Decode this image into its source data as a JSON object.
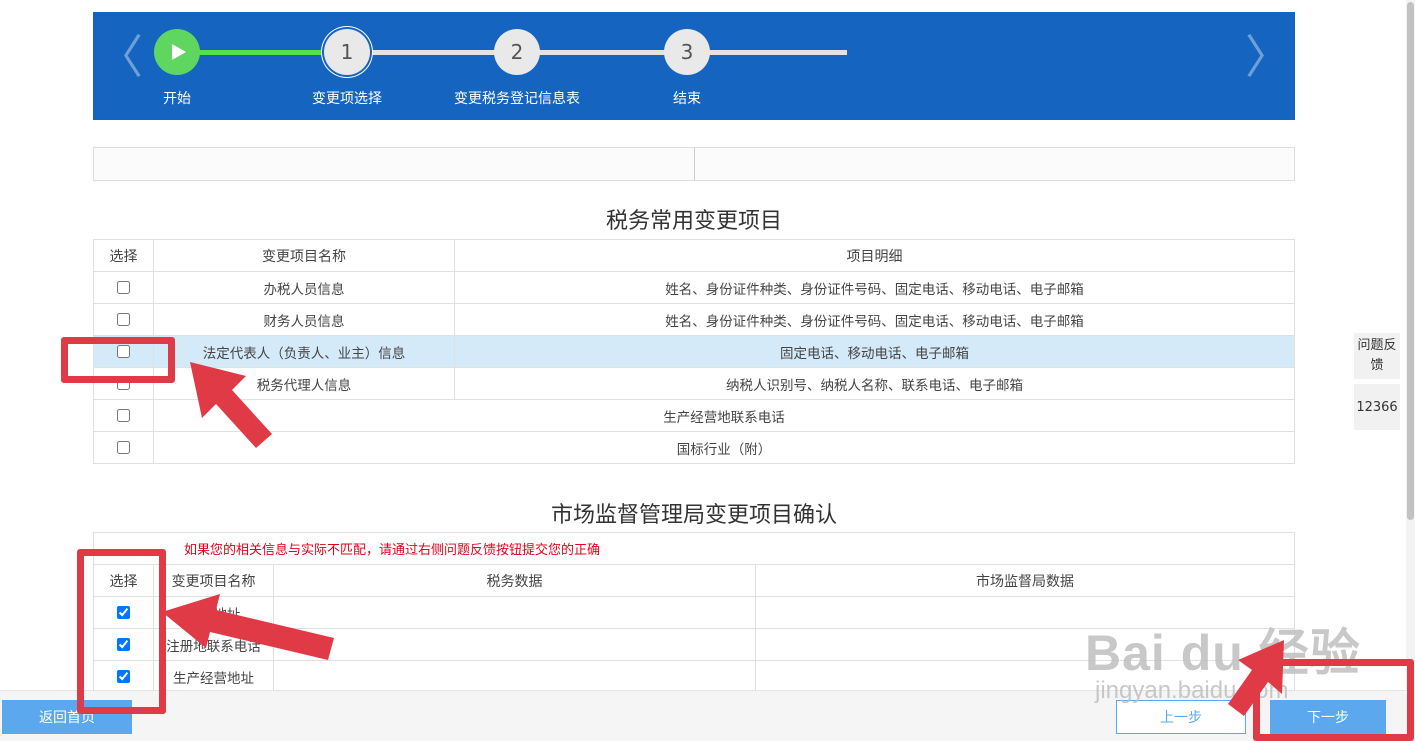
{
  "steps": [
    {
      "label": "开始",
      "number": ""
    },
    {
      "label": "变更项选择",
      "number": "1"
    },
    {
      "label": "变更税务登记信息表",
      "number": "2"
    },
    {
      "label": "结束",
      "number": "3"
    }
  ],
  "nav": {
    "left_arrow": "〈",
    "right_arrow": "〉"
  },
  "tax_section": {
    "title": "税务常用变更项目",
    "headers": [
      "选择",
      "变更项目名称",
      "项目明细"
    ],
    "rows": [
      {
        "name": "办税人员信息",
        "detail": "姓名、身份证件种类、身份证件号码、固定电话、移动电话、电子邮箱",
        "checked": false
      },
      {
        "name": "财务人员信息",
        "detail": "姓名、身份证件种类、身份证件号码、固定电话、移动电话、电子邮箱",
        "checked": false
      },
      {
        "name": "法定代表人（负责人、业主）信息",
        "detail": "固定电话、移动电话、电子邮箱",
        "checked": false
      },
      {
        "name": "税务代理人信息",
        "detail": "纳税人识别号、纳税人名称、联系电话、电子邮箱",
        "checked": false
      },
      {
        "name": "",
        "detail": "生产经营地联系电话",
        "checked": false
      },
      {
        "name": "",
        "detail": "国标行业（附）",
        "checked": false
      }
    ]
  },
  "market_section": {
    "title": "市场监督管理局变更项目确认",
    "notice": "如果您的相关信息与实际不匹配，请通过右侧问题反馈按钮提交您的正确",
    "headers": [
      "选择",
      "变更项目名称",
      "税务数据",
      "市场监督局数据"
    ],
    "rows": [
      {
        "name": "注册地址",
        "checked": true
      },
      {
        "name": "注册地联系电话",
        "checked": true
      },
      {
        "name": "生产经营地址",
        "checked": true
      }
    ]
  },
  "side": {
    "feedback": "问题反馈",
    "phone": "12366"
  },
  "buttons": {
    "home": "返回首页",
    "prev": "上一步",
    "next": "下一步"
  },
  "watermark": {
    "main": "Bai du 经验",
    "sub": "jingyan.baidu.com"
  },
  "colors": {
    "banner": "#1565c0",
    "progress_done": "#52e24a",
    "annotation": "#e13a47",
    "button": "#5ca8ef",
    "notice": "#e4001b"
  }
}
